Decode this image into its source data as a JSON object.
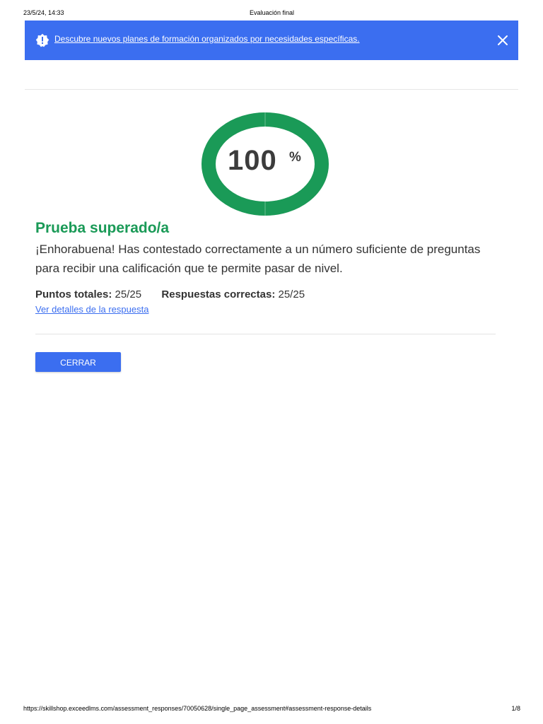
{
  "print_header": {
    "datetime": "23/5/24, 14:33",
    "title": "Evaluación final"
  },
  "banner": {
    "text": "Descubre nuevos planes de formación organizados por necesidades específicas.",
    "icon": "alert-icon",
    "close_icon": "close-icon",
    "background_color": "#3b6ef0"
  },
  "score": {
    "value": "100",
    "unit": "%",
    "fraction": 1.0,
    "ring_color": "#1a9a57"
  },
  "result": {
    "title": "Prueba superado/a",
    "message": "¡Enhorabuena! Has contestado correctamente a un número suficiente de preguntas para recibir una calificación que te permite pasar de nivel."
  },
  "stats": {
    "total_points_label": "Puntos totales:",
    "total_points_value": "25/25",
    "correct_answers_label": "Respuestas correctas:",
    "correct_answers_value": "25/25"
  },
  "details_link": "Ver detalles de la respuesta",
  "close_button": "CERRAR",
  "print_footer": {
    "url": "https://skillshop.exceedlms.com/assessment_responses/70050628/single_page_assessment#assessment-response-details",
    "page": "1/8"
  }
}
